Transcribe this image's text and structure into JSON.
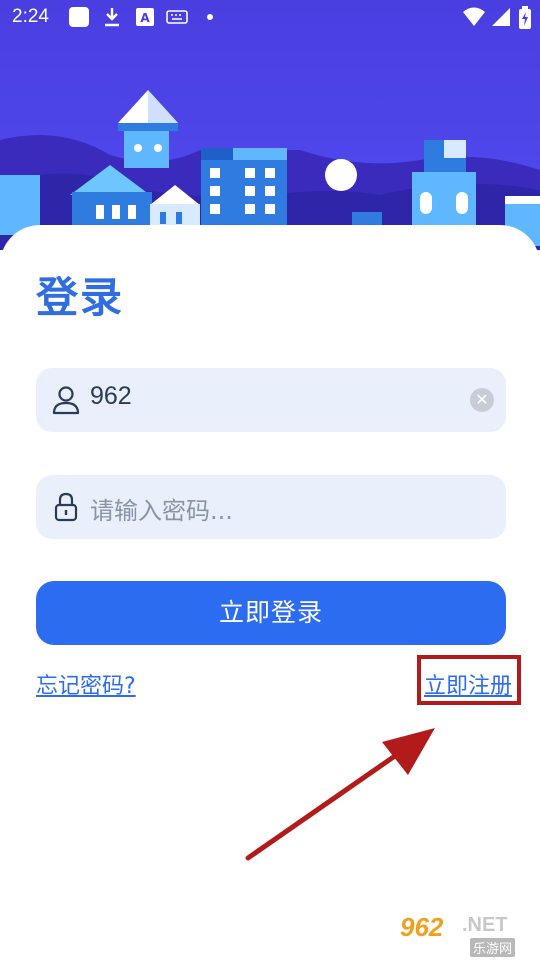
{
  "status_bar": {
    "time": "2:24",
    "left_icons": [
      "app-square-icon",
      "download-icon",
      "a-badge-icon",
      "keyboard-icon",
      "dot-icon"
    ],
    "right_icons": [
      "wifi-icon",
      "cellular-signal-icon",
      "battery-charging-icon"
    ]
  },
  "page": {
    "title": "登录"
  },
  "form": {
    "username": {
      "value": "962",
      "icon": "user-icon",
      "clear_icon": "clear-icon"
    },
    "password": {
      "placeholder": "请输入密码...",
      "icon": "lock-icon"
    },
    "login_button": "立即登录",
    "forgot_link": "忘记密码?",
    "register_link": "立即注册"
  },
  "annotation": {
    "highlight_color": "#b31b1b"
  },
  "watermark": {
    "number": "962",
    "suffix": ".NET",
    "sub": "乐游网"
  },
  "colors": {
    "primary": "#2c6cf0",
    "title": "#2f6de0",
    "field_bg": "#e9f0fc",
    "hero_bg": "#4a3ee0"
  }
}
